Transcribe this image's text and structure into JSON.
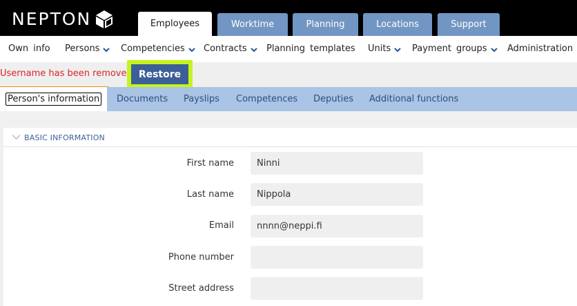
{
  "header": {
    "logo_text": "NEPTON",
    "tabs": [
      {
        "label": "Employees",
        "active": true
      },
      {
        "label": "Worktime",
        "active": false
      },
      {
        "label": "Planning",
        "active": false
      },
      {
        "label": "Locations",
        "active": false
      },
      {
        "label": "Support",
        "active": false
      }
    ]
  },
  "subnav": {
    "items": [
      {
        "label": "Own info",
        "dropdown": false
      },
      {
        "label": "Persons",
        "dropdown": true
      },
      {
        "label": "Competencies",
        "dropdown": true
      },
      {
        "label": "Contracts",
        "dropdown": true
      },
      {
        "label": "Planning templates",
        "dropdown": false
      },
      {
        "label": "Units",
        "dropdown": true
      },
      {
        "label": "Payment groups",
        "dropdown": true
      },
      {
        "label": "Administration",
        "dropdown": false
      }
    ]
  },
  "notice": {
    "message": "Username has been removed",
    "restore_label": "Restore"
  },
  "person_tabs": [
    {
      "label": "Person's information",
      "active": true
    },
    {
      "label": "Documents",
      "active": false
    },
    {
      "label": "Payslips",
      "active": false
    },
    {
      "label": "Competences",
      "active": false
    },
    {
      "label": "Deputies",
      "active": false
    },
    {
      "label": "Additional functions",
      "active": false
    }
  ],
  "basic_info": {
    "title": "BASIC INFORMATION",
    "fields": [
      {
        "label": "First name",
        "value": "Ninni"
      },
      {
        "label": "Last name",
        "value": "Nippola"
      },
      {
        "label": "Email",
        "value": "nnnn@neppi.fi"
      },
      {
        "label": "Phone number",
        "value": ""
      },
      {
        "label": "Street address",
        "value": ""
      }
    ]
  },
  "colors": {
    "header_bg": "#000000",
    "tab_bg": "#7296c3",
    "restore_bg": "#3d5f97",
    "highlight": "#c5f41c",
    "error_text": "#d8232a",
    "tabbar_bg": "#a9c4e4",
    "accent_orange": "#f08a1a"
  }
}
